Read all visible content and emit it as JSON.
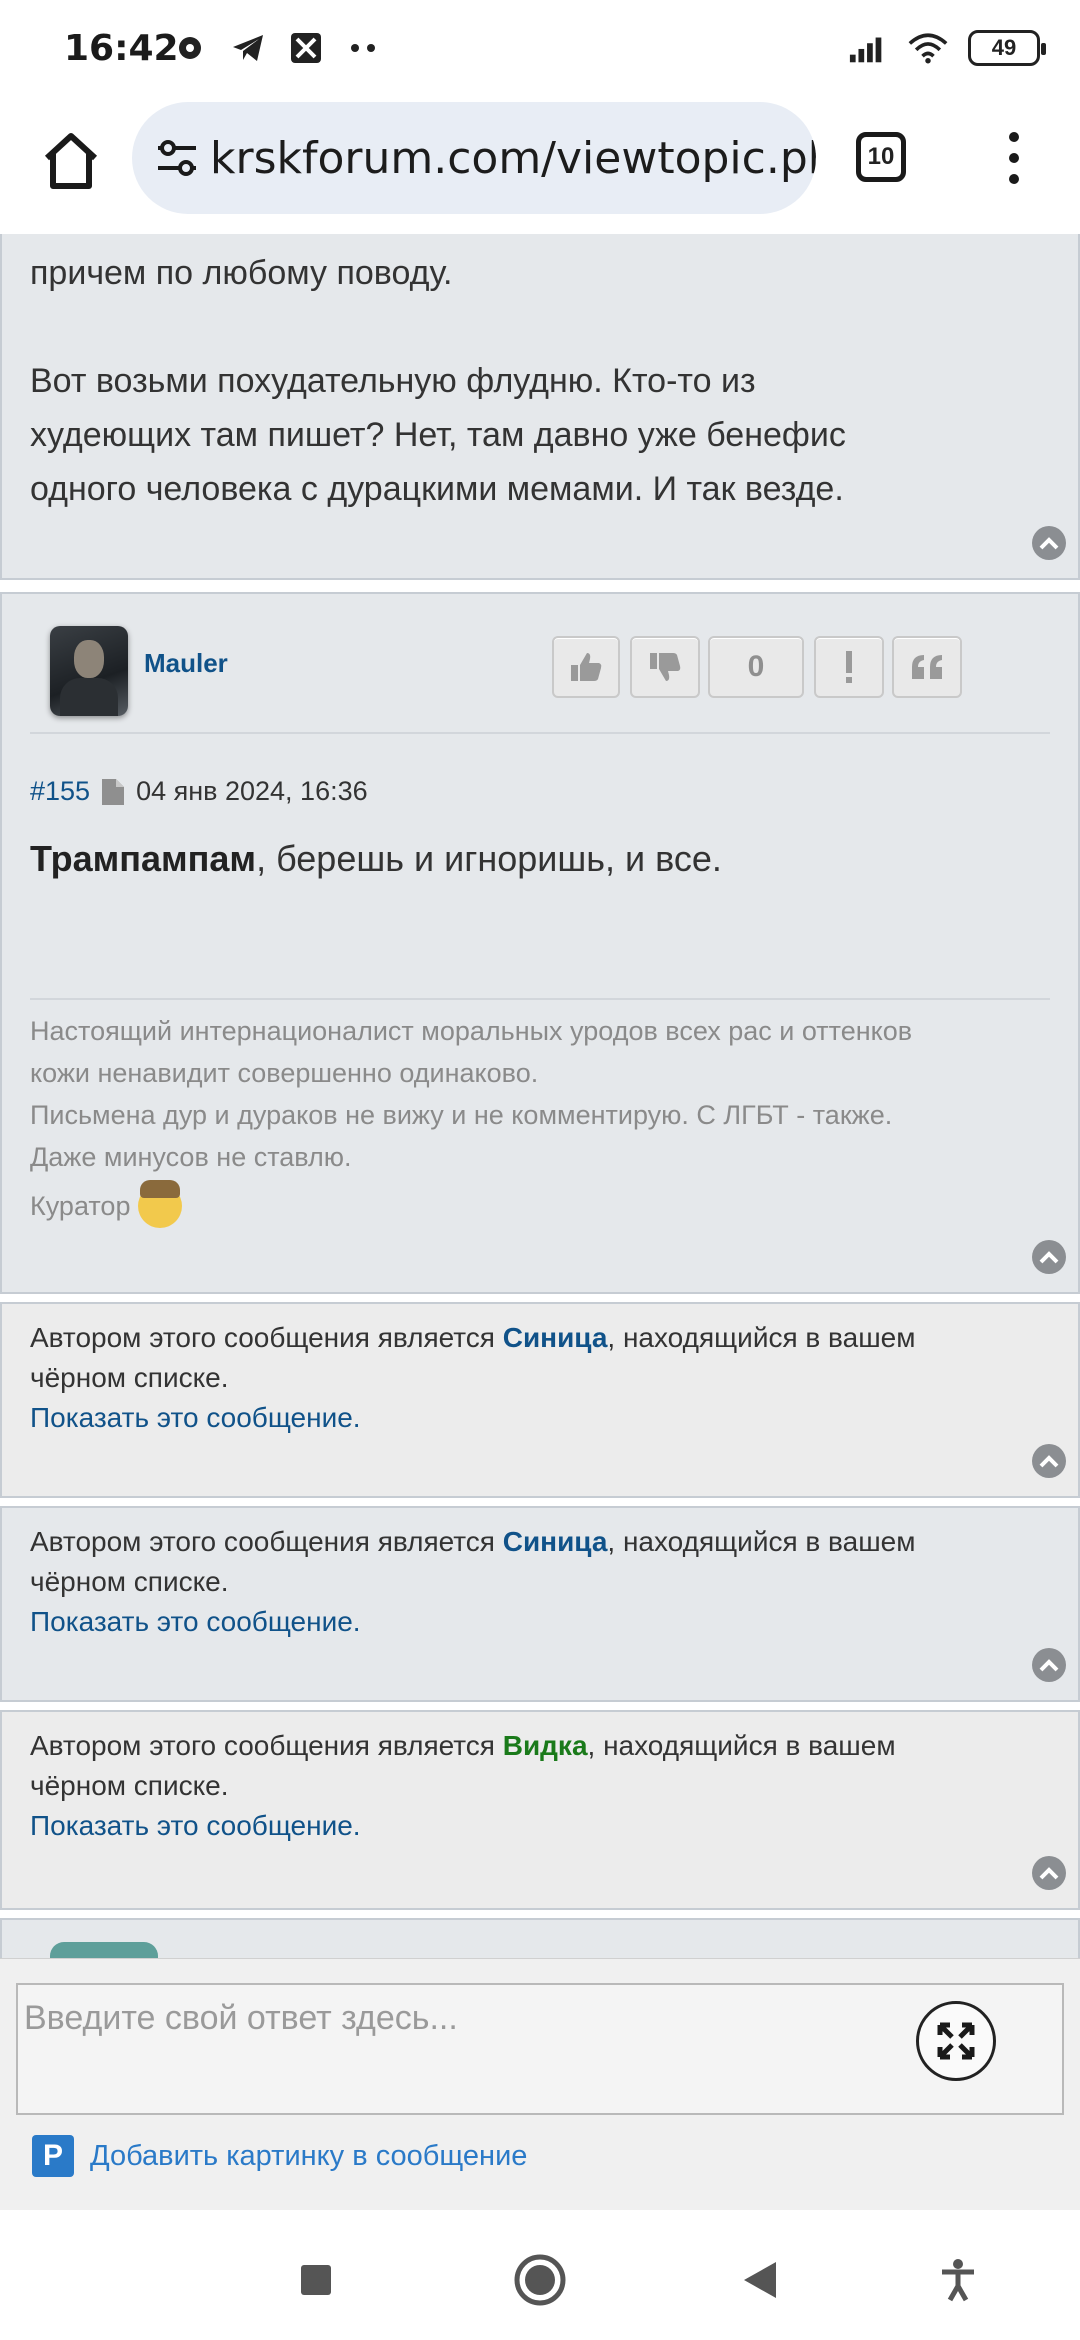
{
  "status_bar": {
    "time": "16:42",
    "battery": "49",
    "icons_left": [
      "record-icon",
      "telegram-icon",
      "app-icon",
      "more-dots-icon"
    ],
    "icons_right": [
      "signal-icon",
      "wifi-icon",
      "battery-icon"
    ]
  },
  "browser": {
    "url": "krskforum.com/viewtopic.php",
    "tab_count": "10"
  },
  "posts": {
    "prev_tail": {
      "line1": "причем по любому поводу.",
      "para2_l1": "Вот возьми похудательную флудню. Кто-то из",
      "para2_l2": "худеющих там пишет? Нет, там давно уже бенефис",
      "para2_l3": "одного человека с дурацкими мемами. И так везде."
    },
    "main": {
      "username": "Mauler",
      "score": "0",
      "post_number": "#155",
      "date": "04 янв 2024, 16:36",
      "body_bold": "Трампампам",
      "body_rest": ", берешь и игноришь, и все.",
      "sig_l1": "Настоящий интернационалист моральных уродов всех рас и оттенков",
      "sig_l2": "кожи ненавидит совершенно одинаково.",
      "sig_l3": "Письмена дур и дураков не вижу и не комментирую. С ЛГБТ - также.",
      "sig_l4": "Даже минусов не ставлю.",
      "curator": "Куратор"
    },
    "blocked": [
      {
        "prefix": "Автором этого сообщения является ",
        "name": "Синица",
        "suffix": ", находящийся в вашем",
        "line2": "чёрном списке.",
        "show": "Показать это сообщение."
      },
      {
        "prefix": "Автором этого сообщения является ",
        "name": "Синица",
        "suffix": ", находящийся в вашем",
        "line2": "чёрном списке.",
        "show": "Показать это сообщение."
      },
      {
        "prefix": "Автором этого сообщения является ",
        "name": "Видка",
        "suffix": ", находящийся в вашем",
        "line2": "чёрном списке.",
        "show": "Показать это сообщение."
      }
    ]
  },
  "reply": {
    "placeholder": "Введите свой ответ здесь...",
    "add_image": "Добавить картинку в сообщение"
  },
  "colors": {
    "link": "#105289",
    "green_name": "#1a7a1a",
    "post_bg": "#e5e8eb",
    "post_bg_alt": "#ececec",
    "accent_blue": "#2a7ac8"
  }
}
